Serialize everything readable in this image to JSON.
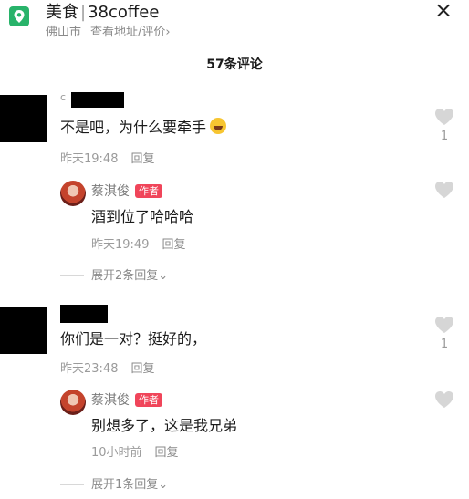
{
  "header": {
    "category": "美食",
    "shop_name": "38coffee",
    "city": "佛山市",
    "address_link": "查看地址/评价",
    "chevron": "›",
    "close": "×"
  },
  "comment_count": "57条评论",
  "comments": [
    {
      "user_partial": "c",
      "text": "不是吧，为什么要牵手",
      "time": "昨天19:48",
      "reply_label": "回复",
      "likes": "1",
      "reply": {
        "author": "蔡淇俊",
        "badge": "作者",
        "text": "酒到位了哈哈哈",
        "time": "昨天19:49",
        "reply_label": "回复"
      },
      "expand": "展开2条回复"
    },
    {
      "text": "你们是一对？挺好的，",
      "time": "昨天23:48",
      "reply_label": "回复",
      "likes": "1",
      "reply": {
        "author": "蔡淇俊",
        "badge": "作者",
        "text": "别想多了，这是我兄弟",
        "time": "10小时前",
        "reply_label": "回复"
      },
      "expand": "展开1条回复"
    }
  ],
  "icons": {
    "location": "location-pin-icon",
    "like": "heart-icon",
    "emoji": "laughing-emoji-icon",
    "expand": "chevron-down-icon"
  },
  "colors": {
    "brand_green": "#28b36a",
    "author_badge": "#f0455a",
    "like_gray": "#d6d6d6"
  }
}
